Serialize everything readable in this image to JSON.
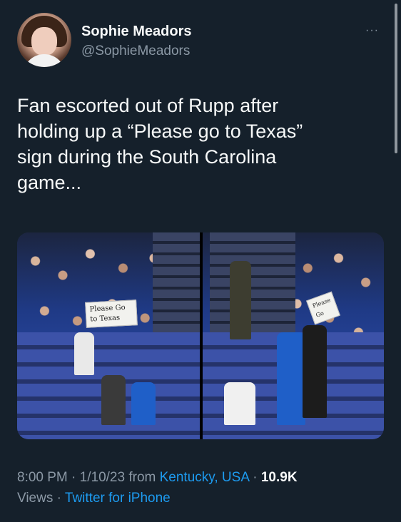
{
  "author": {
    "name": "Sophie Meadors",
    "handle": "@SophieMeadors"
  },
  "menu": {
    "more_label": "···"
  },
  "tweet": {
    "text_lines": [
      "Fan escorted out of Rupp after",
      "holding up a “Please go to Texas”",
      "sign during the South Carolina",
      "game..."
    ]
  },
  "media": {
    "left_sign_text": [
      "Please Go",
      "to Texas"
    ],
    "right_sign_text": "Please Go"
  },
  "meta": {
    "time": "8:00 PM",
    "date": "1/10/23",
    "from_label": "from",
    "location": "Kentucky, USA",
    "views_count": "10.9K",
    "views_label": "Views",
    "source": "Twitter for iPhone",
    "separator": " · "
  }
}
